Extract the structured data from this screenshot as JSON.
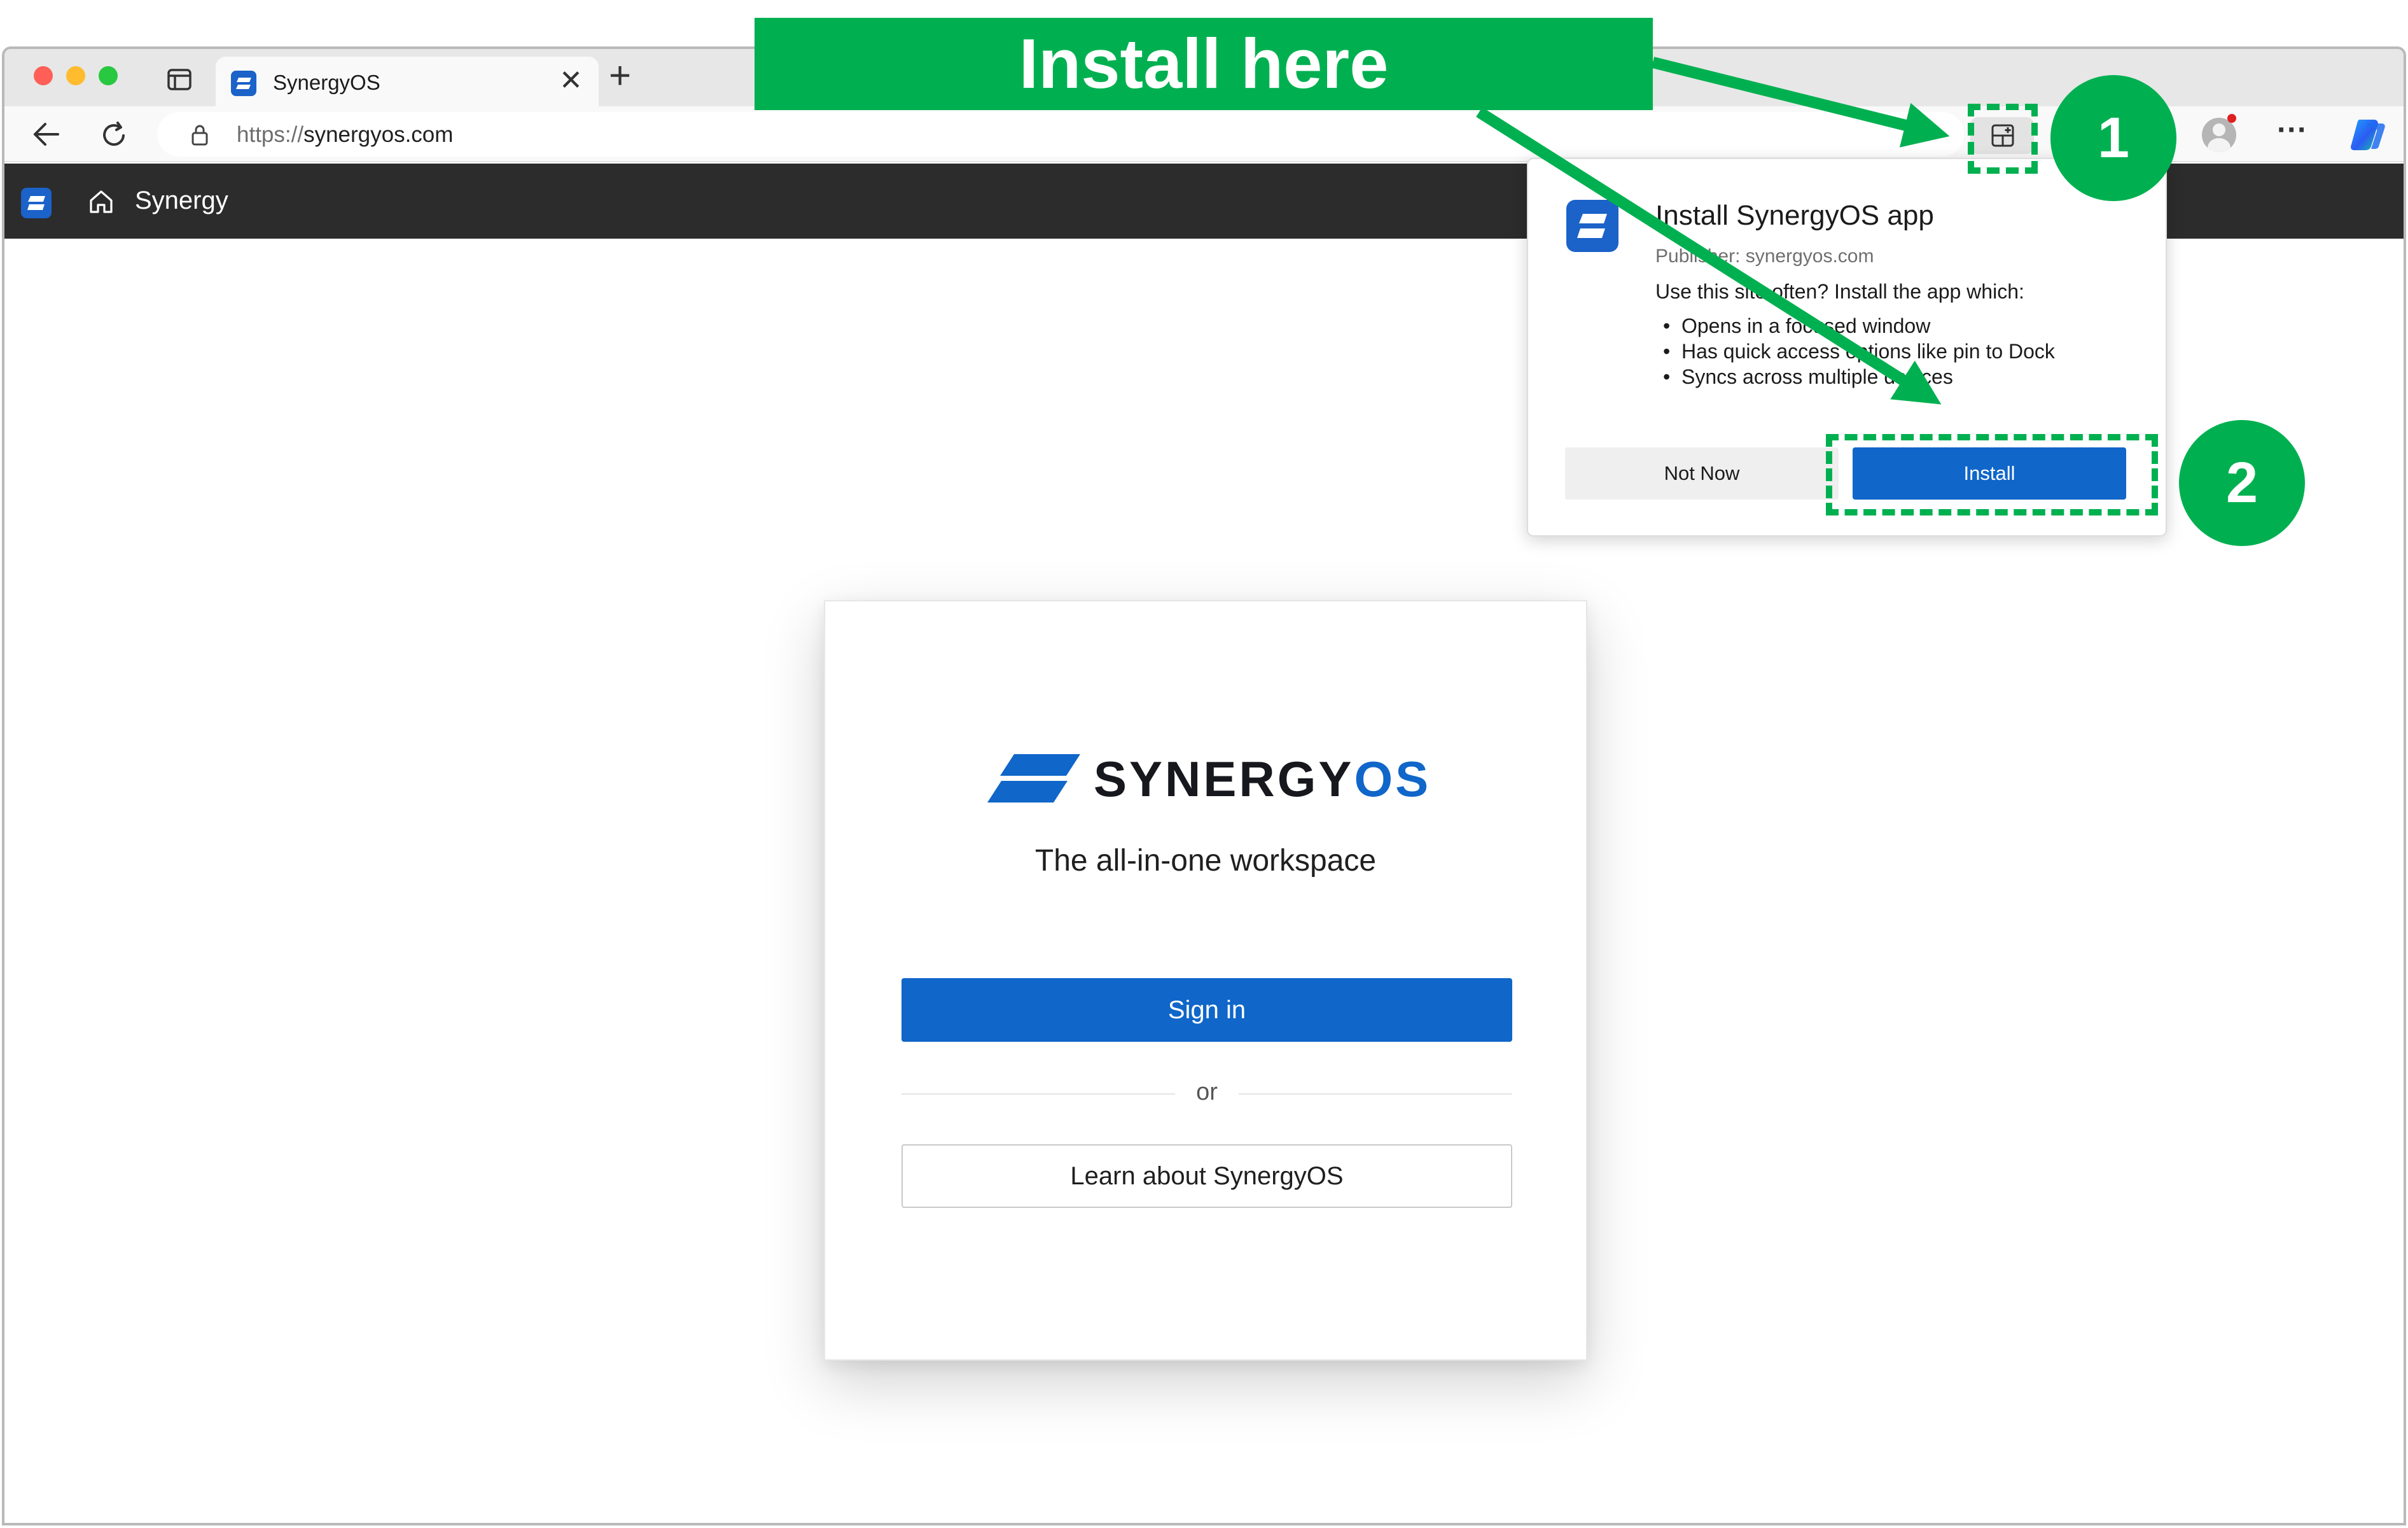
{
  "browser": {
    "tab_title": "SynergyOS",
    "tab_close": "✕",
    "new_tab": "+",
    "url_scheme": "https://",
    "url_host": "synergyos.com",
    "toolbar_more": "···"
  },
  "appbar": {
    "title": "Synergy"
  },
  "card": {
    "brand_main": "SYNERGY",
    "brand_accent": "OS",
    "tagline": "The all-in-one workspace",
    "signin_label": "Sign in",
    "or_label": "or",
    "learn_label": "Learn about SynergyOS"
  },
  "popup": {
    "title": "Install SynergyOS app",
    "publisher": "Publisher: synergyos.com",
    "question": "Use this site often? Install the app which:",
    "features": [
      "Opens in a focused window",
      "Has quick access options like pin to Dock",
      "Syncs across multiple devices"
    ],
    "not_now_label": "Not Now",
    "install_label": "Install"
  },
  "annotations": {
    "banner": "Install here",
    "step1": "1",
    "step2": "2",
    "color": "#00b050"
  },
  "colors": {
    "brand_blue": "#1066c9",
    "appbar_bg": "#2c2c2c"
  }
}
